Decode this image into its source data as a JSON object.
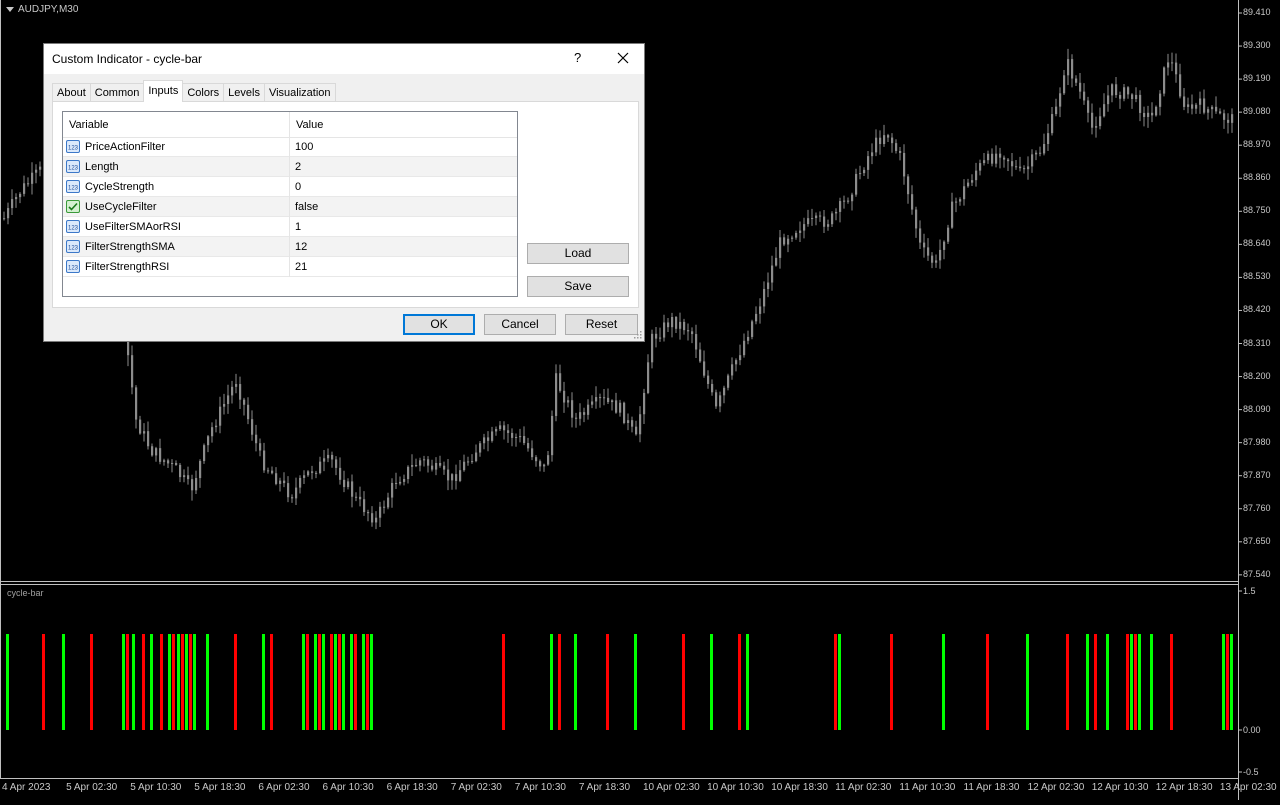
{
  "chart": {
    "title": "AUDJPY,M30",
    "indicator_title": "cycle-bar",
    "candle_color": "#8c8c8c",
    "bull_color": "#00ff00",
    "bear_color": "#ff0000",
    "price_labels": [
      "89.410",
      "89.300",
      "89.190",
      "89.080",
      "88.970",
      "88.860",
      "88.750",
      "88.640",
      "88.530",
      "88.420",
      "88.310",
      "88.200",
      "88.090",
      "87.980",
      "87.870",
      "87.760",
      "87.650",
      "87.540"
    ],
    "indicator_labels": [
      "1.5",
      "0.00",
      "-0.5"
    ],
    "time_labels": [
      "4 Apr 2023",
      "5 Apr 02:30",
      "5 Apr 10:30",
      "5 Apr 18:30",
      "6 Apr 02:30",
      "6 Apr 10:30",
      "6 Apr 18:30",
      "7 Apr 02:30",
      "7 Apr 10:30",
      "7 Apr 18:30",
      "10 Apr 02:30",
      "10 Apr 10:30",
      "10 Apr 18:30",
      "11 Apr 02:30",
      "11 Apr 10:30",
      "11 Apr 18:30",
      "12 Apr 02:30",
      "12 Apr 10:30",
      "12 Apr 18:30",
      "13 Apr 02:30"
    ]
  },
  "dialog": {
    "title": "Custom Indicator - cycle-bar",
    "help": "?",
    "tabs": [
      "About",
      "Common",
      "Inputs",
      "Colors",
      "Levels",
      "Visualization"
    ],
    "active_tab": "Inputs",
    "grid": {
      "col_variable": "Variable",
      "col_value": "Value",
      "rows": [
        {
          "variable": "PriceActionFilter",
          "value": "100",
          "icon": "numeric-icon"
        },
        {
          "variable": "Length",
          "value": "2",
          "icon": "numeric-icon"
        },
        {
          "variable": "CycleStrength",
          "value": "0",
          "icon": "numeric-icon"
        },
        {
          "variable": "UseCycleFilter",
          "value": "false",
          "icon": "boolean-icon"
        },
        {
          "variable": "UseFilterSMAorRSI",
          "value": "1",
          "icon": "numeric-icon"
        },
        {
          "variable": "FilterStrengthSMA",
          "value": "12",
          "icon": "numeric-icon"
        },
        {
          "variable": "FilterStrengthRSI",
          "value": "21",
          "icon": "numeric-icon"
        }
      ]
    },
    "load_label": "Load",
    "save_label": "Save",
    "ok_label": "OK",
    "cancel_label": "Cancel",
    "reset_label": "Reset"
  }
}
